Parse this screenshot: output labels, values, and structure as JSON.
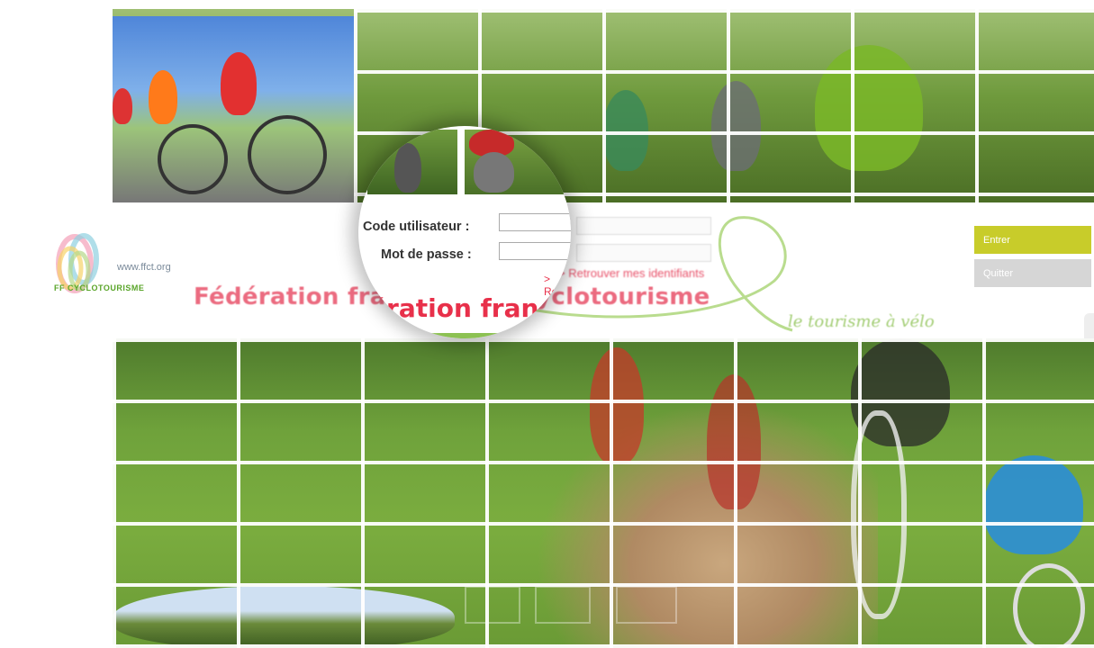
{
  "banner": {
    "site_url": "www.ffct.org",
    "logo_text": "FF CYCLOTOURISME",
    "title": "Fédération française de cyclotourisme",
    "tagline": "le tourisme à vélo"
  },
  "login": {
    "code_label": "Code utilisateur :",
    "password_label": "Mot de passe :",
    "recover_link": "> Retrouver mes identifiants",
    "magnified_title": "Fédération française de cyclotourisme"
  },
  "buttons": {
    "enter_label": "Entrer",
    "quit_label": "Quitter"
  },
  "colors": {
    "brand_pink": "#e8526a",
    "brand_green": "#8cc152",
    "enter_button": "#c8cc2a",
    "quit_button": "#d6d6d6"
  }
}
